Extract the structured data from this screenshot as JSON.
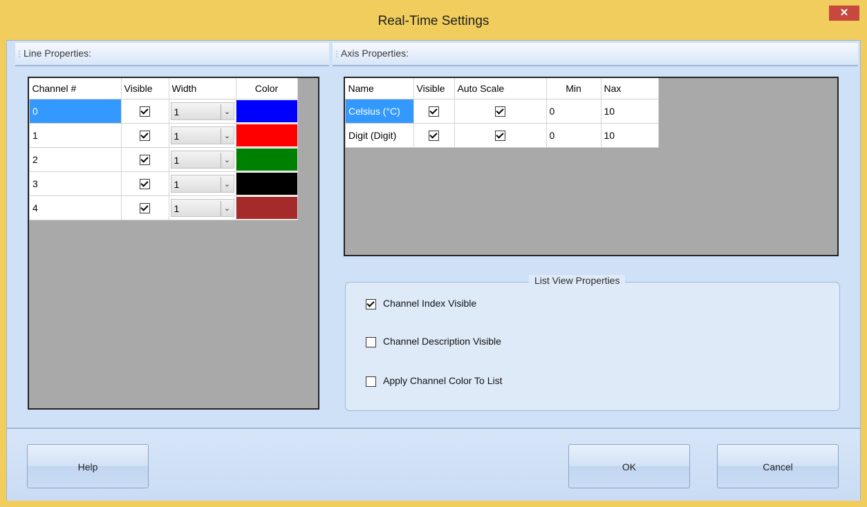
{
  "window": {
    "title": "Real-Time Settings",
    "close_symbol": "✕"
  },
  "line_properties": {
    "header": "Line Properties:",
    "columns": [
      "Channel #",
      "Visible",
      "Width",
      "Color"
    ],
    "rows": [
      {
        "channel": "0",
        "visible": true,
        "width": "1",
        "color": "#0000ff"
      },
      {
        "channel": "1",
        "visible": true,
        "width": "1",
        "color": "#ff0000"
      },
      {
        "channel": "2",
        "visible": true,
        "width": "1",
        "color": "#008000"
      },
      {
        "channel": "3",
        "visible": true,
        "width": "1",
        "color": "#000000"
      },
      {
        "channel": "4",
        "visible": true,
        "width": "1",
        "color": "#a52a2a"
      }
    ]
  },
  "axis_properties": {
    "header": "Axis Properties:",
    "columns": [
      "Name",
      "Visible",
      "Auto Scale",
      "Min",
      "Nax"
    ],
    "rows": [
      {
        "name": "Celsius (°C)",
        "visible": true,
        "auto_scale": true,
        "min": "0",
        "max": "10"
      },
      {
        "name": "Digit (Digit)",
        "visible": true,
        "auto_scale": true,
        "min": "0",
        "max": "10"
      }
    ]
  },
  "list_view": {
    "legend": "List View Properties",
    "options": [
      {
        "label": "Channel Index Visible",
        "checked": true
      },
      {
        "label": "Channel Description Visible",
        "checked": false
      },
      {
        "label": "Apply Channel Color To List",
        "checked": false
      }
    ]
  },
  "buttons": {
    "help": "Help",
    "ok": "OK",
    "cancel": "Cancel"
  }
}
